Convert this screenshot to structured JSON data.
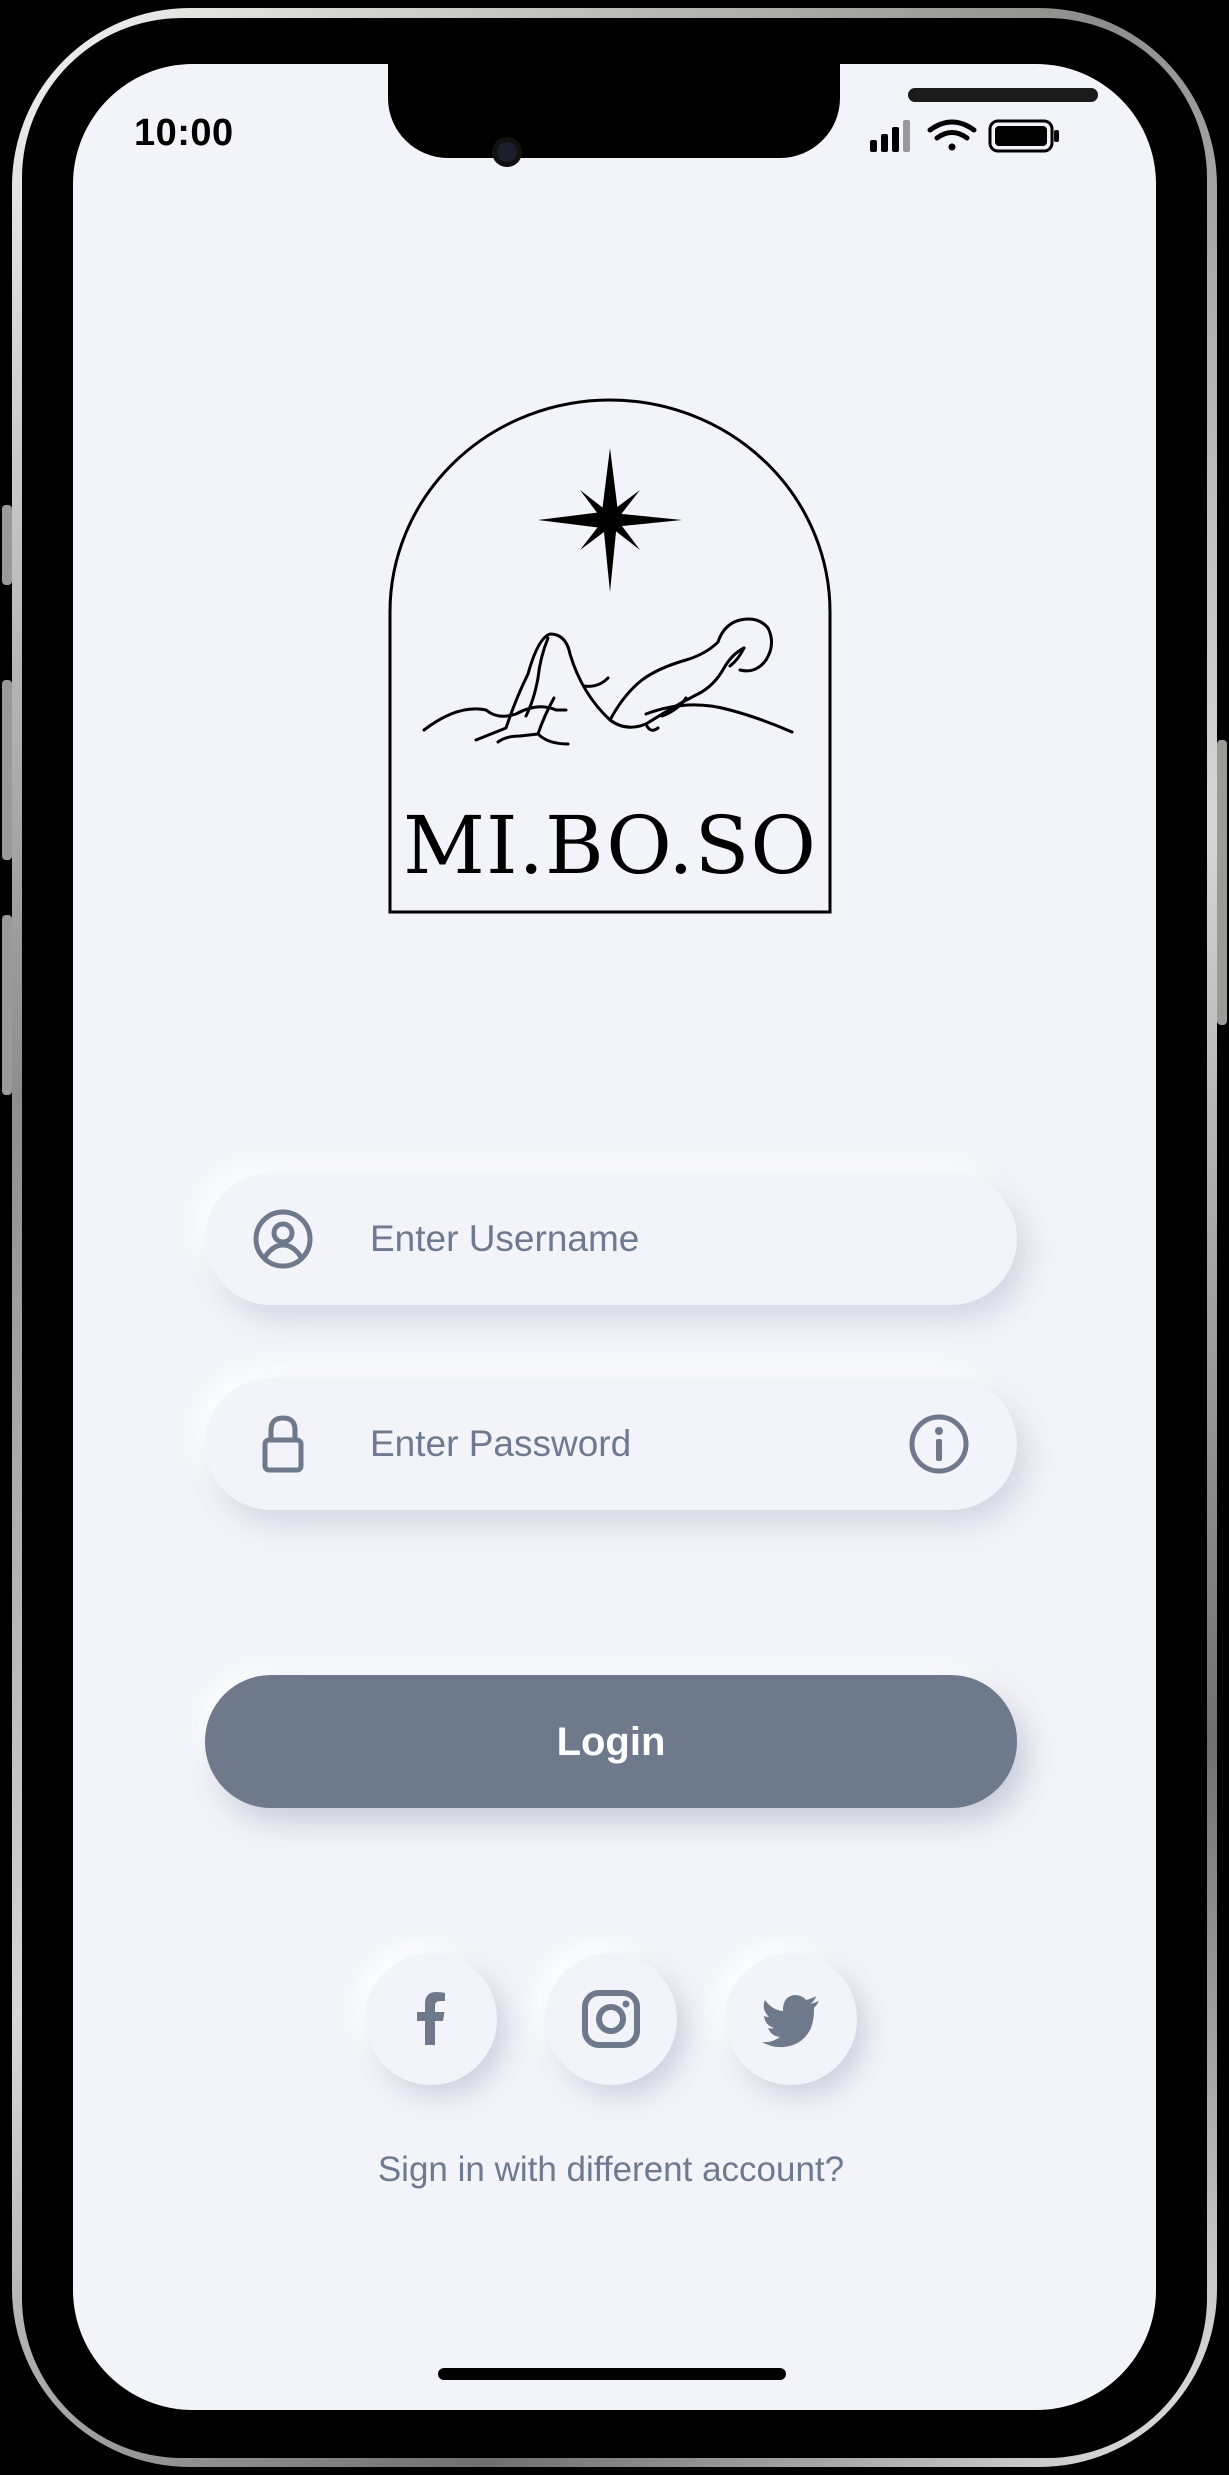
{
  "status_bar": {
    "time": "10:00"
  },
  "brand": {
    "name": "MI.BO.SO"
  },
  "form": {
    "username_placeholder": "Enter Username",
    "password_placeholder": "Enter Password",
    "login_label": "Login"
  },
  "social": [
    {
      "icon": "facebook-icon"
    },
    {
      "icon": "instagram-icon"
    },
    {
      "icon": "twitter-icon"
    }
  ],
  "alt_sign_in": "Sign in with different account?",
  "colors": {
    "background": "#f3f4f9",
    "accent": "#6e798c",
    "text": "#6e7a8f"
  }
}
